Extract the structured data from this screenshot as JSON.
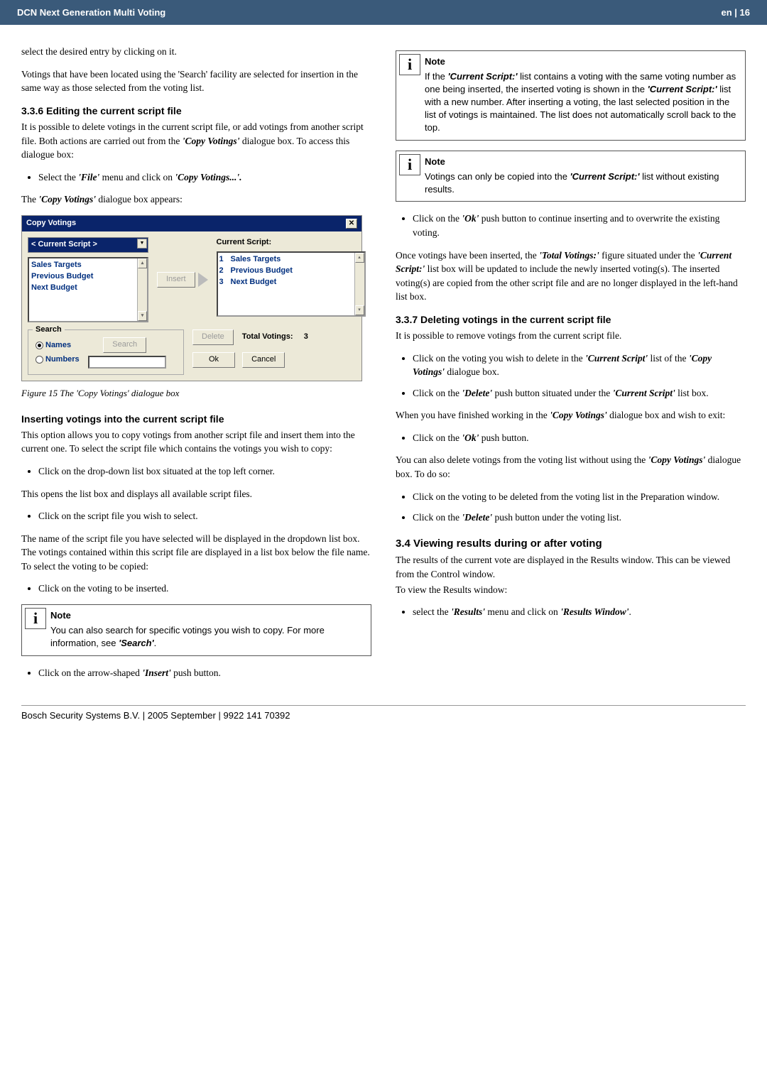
{
  "header": {
    "title_left": "DCN Next Generation Multi Voting",
    "title_right": "en | 16"
  },
  "left": {
    "intro_select": "select the desired entry by clicking on it.",
    "search_para": "Votings that have been located using the 'Search' facility are selected for insertion in the same way as those selected from the voting list.",
    "h336": "3.3.6 Editing the current script file",
    "p336": "It is possible to delete votings in the current script file, or add votings from another script file. Both actions are carried out from the ",
    "p336b": " dialogue box. To access this dialogue box:",
    "copy_votings_bold": "'Copy Votings'",
    "bul1a": "Select the ",
    "bul1file": "'File'",
    "bul1b": " menu and click on ",
    "bul1copy": "'Copy Votings...'.",
    "dlg_appears_a": "The ",
    "dlg_appears_b": " dialogue box appears:",
    "fig_caption": "Figure 15 The 'Copy Votings' dialogue box",
    "h_insert": "Inserting votings into the current script file",
    "p_insert": "This option allows you to copy votings from another script file and insert them into the current one. To select the script file which contains the votings you wish to copy:",
    "bul_drop": "Click on the drop-down list box situated at the top left corner.",
    "p_opens": "This opens the list box and displays all available script files.",
    "bul_click_scriptfile": "Click on the script file you wish to select.",
    "p_name": "The name of the script file you have selected will be displayed in the dropdown list box. The votings contained within this script file are displayed in a list box below the file name. To select the voting to be copied:",
    "bul_click_voting": "Click on the voting to be inserted.",
    "note_title": "Note",
    "note_body_a": "You can also search for specific votings you wish to copy. For more information, see ",
    "note_body_b": "'Search'",
    "note_body_c": ".",
    "bul_arrow_a": "Click on the arrow-shaped ",
    "bul_arrow_b": "'Insert'",
    "bul_arrow_c": " push button."
  },
  "dialog": {
    "title": "Copy Votings",
    "script_sel": "< Current Script >",
    "left_items": [
      "Sales Targets",
      "Previous Budget",
      "Next Budget"
    ],
    "insert_btn": "Insert",
    "curscript_label": "Current Script:",
    "right_nums": [
      "1",
      "2",
      "3"
    ],
    "right_items": [
      "Sales Targets",
      "Previous Budget",
      "Next Budget"
    ],
    "search_legend": "Search",
    "radio_names": "Names",
    "radio_numbers": "Numbers",
    "search_btn": "Search",
    "delete_btn": "Delete",
    "total_label": "Total Votings:",
    "total_value": "3",
    "ok": "Ok",
    "cancel": "Cancel"
  },
  "right": {
    "note1_title": "Note",
    "note1_a": "If the ",
    "note1_b": "'Current Script:'",
    "note1_c": " list contains a voting with the same voting number as one being inserted, the inserted voting is shown in the ",
    "note1_d": "'Current Script:'",
    "note1_e": " list with a new number. After inserting a voting, the last selected position in the list of votings is maintained. The list does not automatically scroll back to the top.",
    "note2_title": "Note",
    "note2_a": "Votings can only be copied into the ",
    "note2_b": "'Current Script:'",
    "note2_c": " list without existing results.",
    "bul_ok_a": "Click on the ",
    "bul_ok_b": "'Ok'",
    "bul_ok_c": " push button to continue inserting and to overwrite the existing voting.",
    "p_once_a": "Once votings have been inserted, the ",
    "p_once_tv": "'Total Votings:'",
    "p_once_b": " figure situated under the ",
    "p_once_cs": "'Current Script:'",
    "p_once_c": " list box will be updated to include the newly inserted voting(s). The inserted voting(s) are copied from the other script file and are no longer displayed in the left-hand list box.",
    "h337": "3.3.7 Deleting votings in the current script file",
    "p337": "It is possible to remove votings from the current script file.",
    "bul337_1a": "Click on the voting you wish to delete in the ",
    "bul337_1b": "'Current Script'",
    "bul337_1c": " list of the ",
    "bul337_1d": "'Copy Votings'",
    "bul337_1e": " dialogue box.",
    "bul337_2a": "Click on the ",
    "bul337_2b": "'Delete'",
    "bul337_2c": " push button situated under the ",
    "bul337_2d": "'Current Script'",
    "bul337_2e": " list box.",
    "p_finish_a": "When you have finished working in the ",
    "p_finish_b": "'Copy Votings'",
    "p_finish_c": " dialogue box and wish to exit:",
    "bul_finish_a": "Click on the ",
    "bul_finish_b": "'Ok'",
    "bul_finish_c": " push button.",
    "p_also_a": "You can also delete votings from the voting list without using the ",
    "p_also_b": "'Copy Votings'",
    "p_also_c": " dialogue box. To do so:",
    "bul_prep": "Click on the voting to be deleted from the voting list in the Preparation window.",
    "bul_del2_a": "Click on the ",
    "bul_del2_b": "'Delete'",
    "bul_del2_c": " push button under the voting list.",
    "h34": "3.4   Viewing results during or after voting",
    "p34": "The results of the current vote are displayed in the Results window. This can be viewed from the Control window.",
    "p34b": "To view the Results window:",
    "bul34_a": "select the ",
    "bul34_b": "'Results'",
    "bul34_c": " menu and click on ",
    "bul34_d": "'Results Window'",
    "bul34_e": "."
  },
  "footer": "Bosch Security Systems B.V. | 2005 September | 9922 141 70392"
}
